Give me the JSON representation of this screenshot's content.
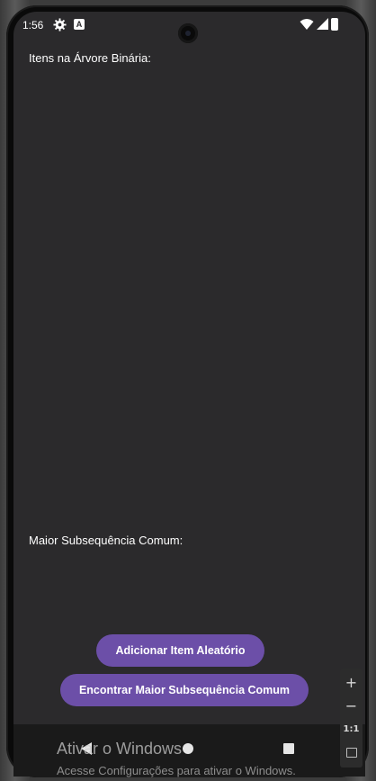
{
  "status_bar": {
    "time": "1:56",
    "icons": [
      "gear-icon",
      "a-notification-icon",
      "wifi-icon",
      "signal-icon",
      "battery-icon"
    ]
  },
  "app": {
    "tree_label": "Itens na Árvore Binária:",
    "lcs_label": "Maior Subsequência Comum:",
    "add_button": "Adicionar Item Aleatório",
    "find_button": "Encontrar Maior Subsequência Comum",
    "accent_color": "#6c4fa8",
    "background_color": "#2b2a2c"
  },
  "nav_bar": {
    "icons": [
      "back-icon",
      "home-icon",
      "recents-icon"
    ]
  },
  "watermark": {
    "title": "Ativar o Windows",
    "subtitle": "Acesse Configurações para ativar o Windows."
  },
  "emulator_zoom": {
    "plus": "+",
    "minus": "−",
    "one_to_one": "1:1"
  }
}
